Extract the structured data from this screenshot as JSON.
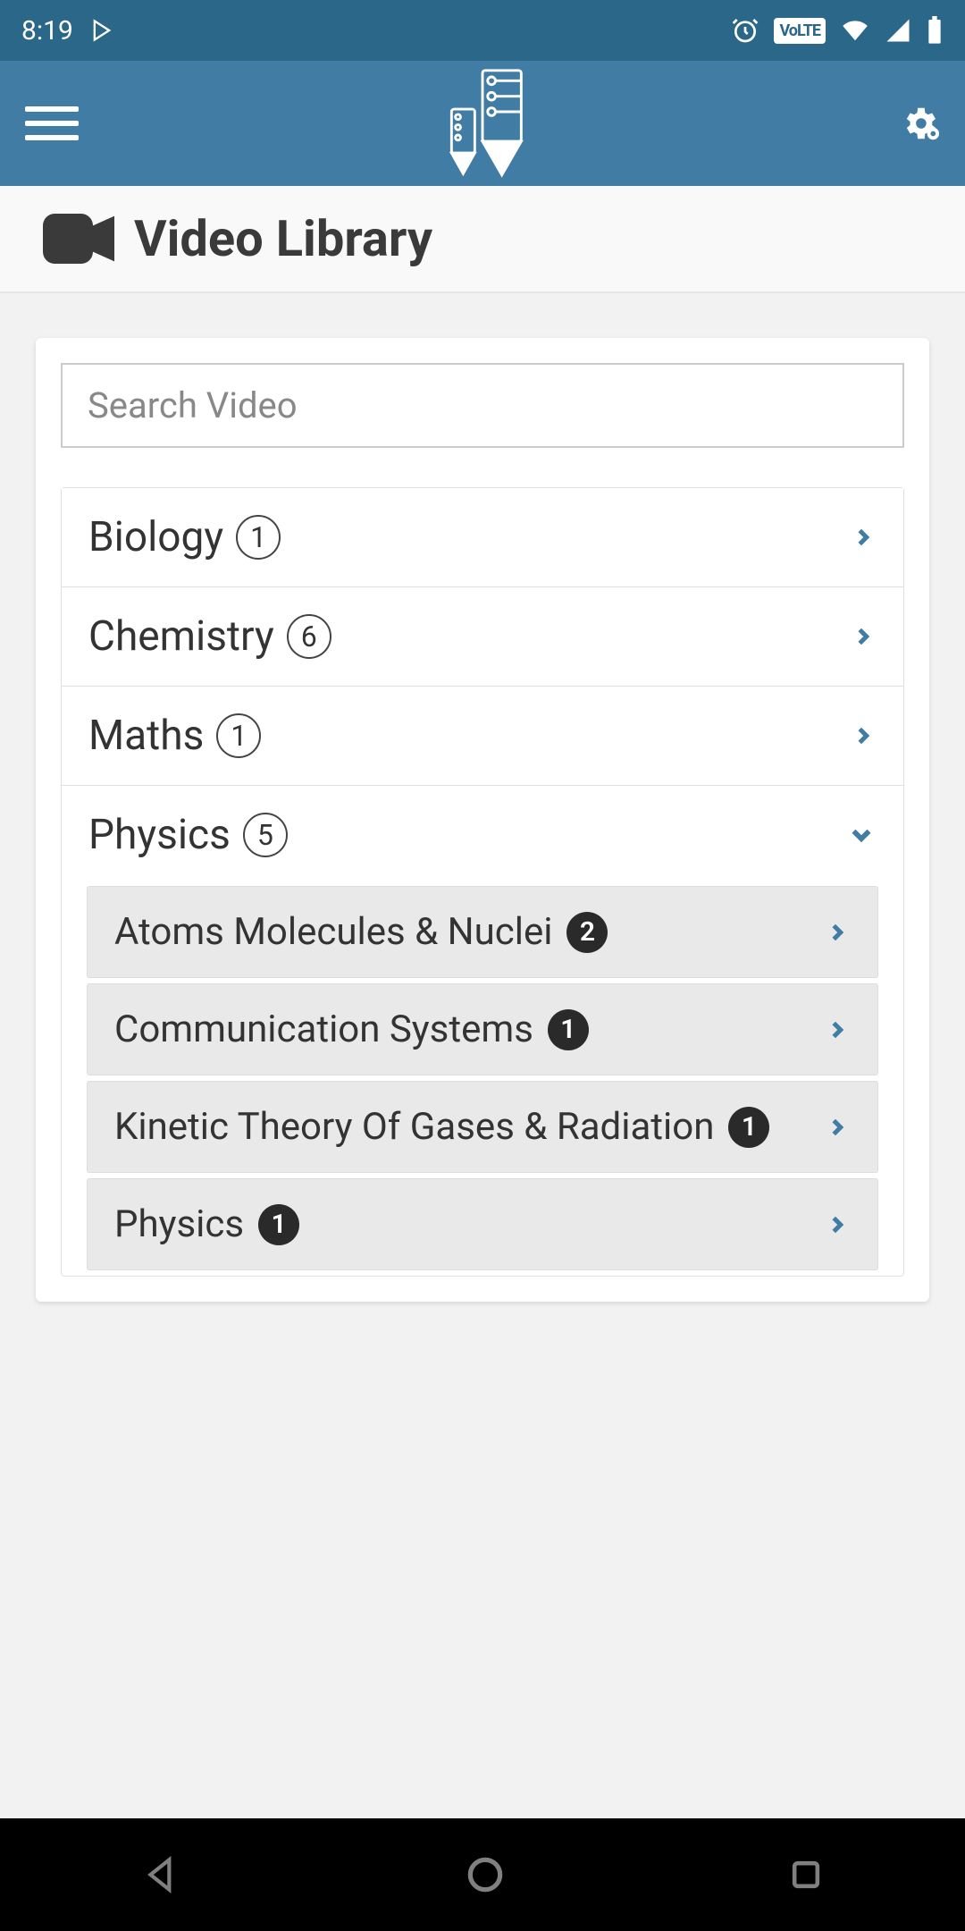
{
  "status_bar": {
    "time": "8:19",
    "volte": "VoLTE"
  },
  "page": {
    "title": "Video Library"
  },
  "search": {
    "placeholder": "Search Video",
    "value": ""
  },
  "categories": [
    {
      "name": "Biology",
      "count": "1",
      "expanded": false
    },
    {
      "name": "Chemistry",
      "count": "6",
      "expanded": false
    },
    {
      "name": "Maths",
      "count": "1",
      "expanded": false
    },
    {
      "name": "Physics",
      "count": "5",
      "expanded": true
    }
  ],
  "subcategories_expanded": [
    {
      "name": "Atoms Molecules & Nuclei",
      "count": "2"
    },
    {
      "name": "Communication Systems",
      "count": "1"
    },
    {
      "name": "Kinetic Theory Of Gases & Radiation",
      "count": "1"
    },
    {
      "name": "Physics",
      "count": "1"
    }
  ],
  "colors": {
    "primary": "#407ca3",
    "primary_dark": "#2b6789",
    "text": "#333333",
    "bg": "#f2f2f2"
  }
}
